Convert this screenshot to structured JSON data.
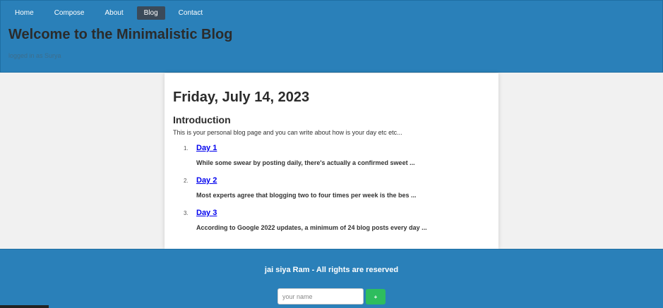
{
  "nav": {
    "items": [
      {
        "label": "Home",
        "active": false
      },
      {
        "label": "Compose",
        "active": false
      },
      {
        "label": "About",
        "active": false
      },
      {
        "label": "Blog",
        "active": true
      },
      {
        "label": "Contact",
        "active": false
      }
    ]
  },
  "header": {
    "title": "Welcome to the Minimalistic Blog",
    "logged_in": "logged in as Surya"
  },
  "main": {
    "date": "Friday, July 14, 2023",
    "intro_heading": "Introduction",
    "intro_text": "This is your personal blog page and you can write about how is your day etc etc...",
    "posts": [
      {
        "number": "1.",
        "title": "Day 1",
        "excerpt": "While some swear by posting daily, there's actually a confirmed sweet ..."
      },
      {
        "number": "2.",
        "title": "Day 2",
        "excerpt": "Most experts agree that blogging two to four times per week is the bes ..."
      },
      {
        "number": "3.",
        "title": "Day 3",
        "excerpt": "According to Google 2022 updates, a minimum of 24 blog posts every day ..."
      }
    ]
  },
  "footer": {
    "text": "jai siya Ram - All rights are reserved",
    "name_placeholder": "your name",
    "submit_label": "+"
  },
  "colors": {
    "header_bg": "#2a80b9",
    "active_nav": "#3b4a59",
    "submit_green": "#2ebd5e",
    "link_blue": "#0000ee"
  }
}
